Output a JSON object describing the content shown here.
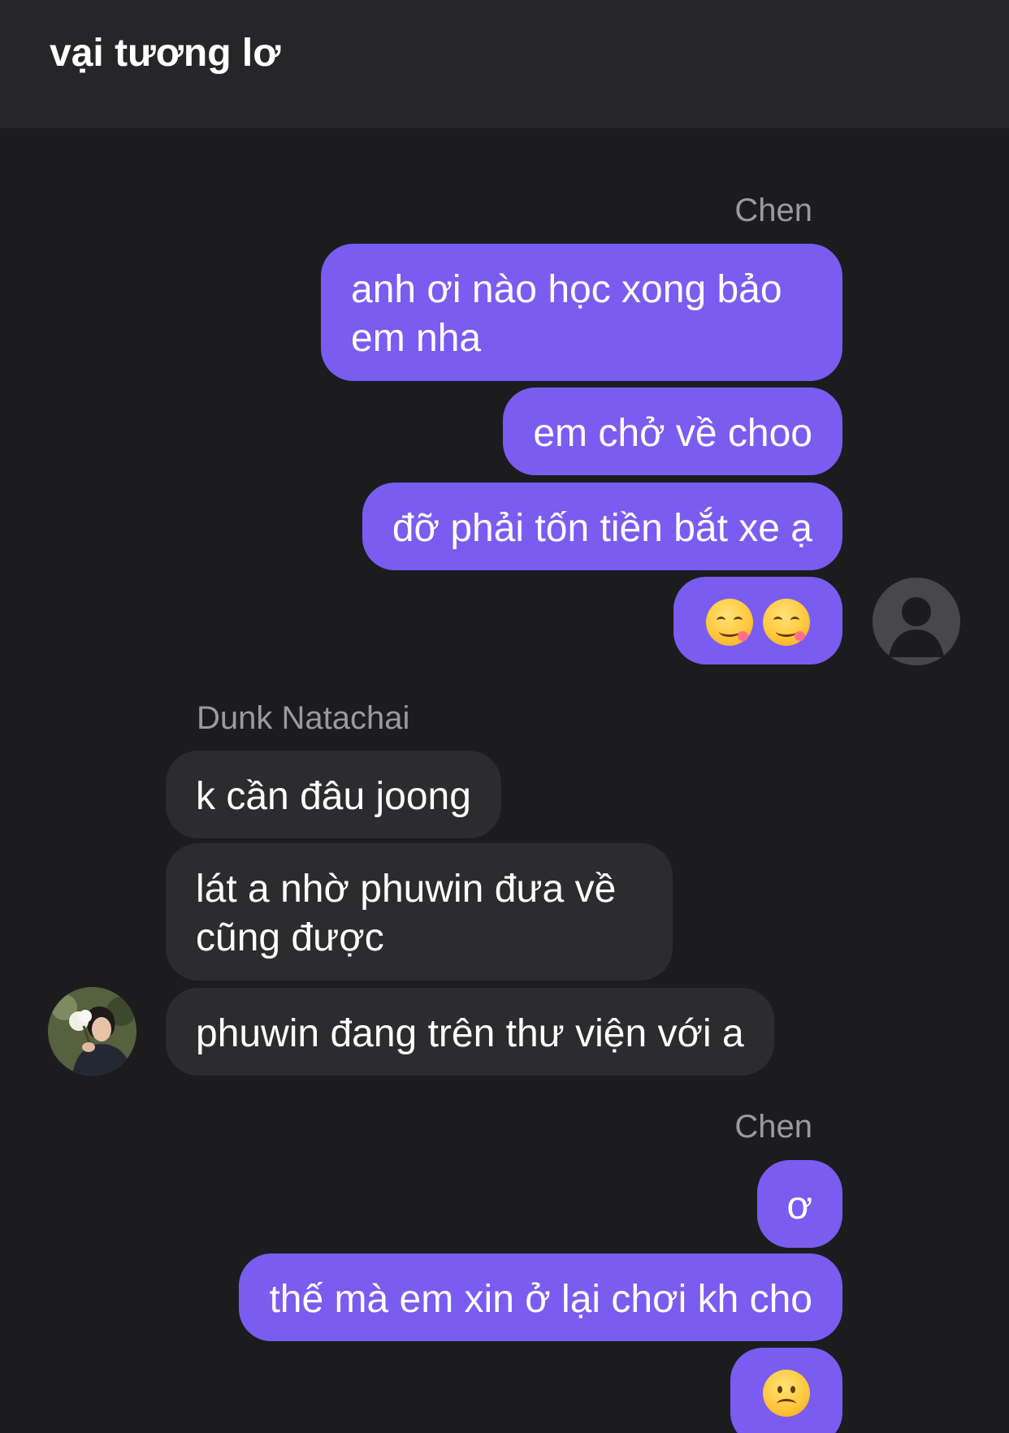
{
  "header": {
    "title": "vại tương lơ"
  },
  "chat": {
    "group1": {
      "sender": "Chen",
      "messages": [
        {
          "line1": "anh ơi nào học xong bảo",
          "line2": "em nha"
        },
        {
          "text": "em chở về choo"
        },
        {
          "text": "đỡ phải tốn tiền bắt xe ạ"
        },
        {
          "emojis": [
            "face-savoring-food-emoji",
            "face-savoring-food-emoji"
          ]
        }
      ]
    },
    "group2": {
      "sender": "Dunk Natachai",
      "messages": [
        {
          "text": "k cần đâu joong"
        },
        {
          "line1": "lát a nhờ phuwin đưa về",
          "line2": "cũng được"
        },
        {
          "text": "phuwin đang trên thư viện với a"
        }
      ]
    },
    "group3": {
      "sender": "Chen",
      "messages": [
        {
          "text": "ơ"
        },
        {
          "text": "thế mà em xin ở lại chơi kh cho"
        },
        {
          "emojis": [
            "frowning-face-emoji"
          ]
        }
      ]
    }
  },
  "colors": {
    "background": "#1c1c1e",
    "header": "#262628",
    "outgoing_bubble": "#7a5cf0",
    "incoming_bubble": "#2c2c2e",
    "sender_name": "#9a9aa0"
  }
}
